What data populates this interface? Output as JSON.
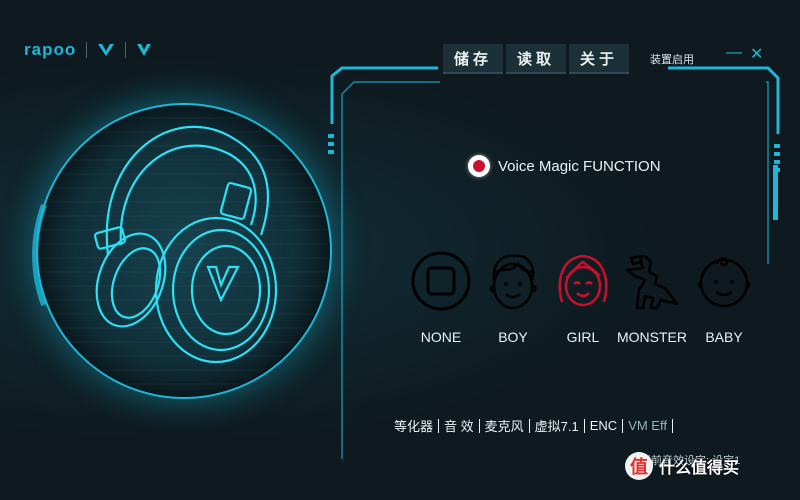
{
  "brand": {
    "name": "rapoo"
  },
  "toolbar": {
    "save_label": "储存",
    "load_label": "读取",
    "about_label": "关于",
    "startup_label": "装置启用",
    "minimize_symbol": "—",
    "close_symbol": "✕"
  },
  "voice_magic": {
    "title": "Voice Magic FUNCTION",
    "enabled": true,
    "modes": [
      {
        "label": "NONE",
        "icon": "none-square-icon",
        "active": false
      },
      {
        "label": "BOY",
        "icon": "boy-face-icon",
        "active": false
      },
      {
        "label": "GIRL",
        "icon": "girl-face-icon",
        "active": true
      },
      {
        "label": "MONSTER",
        "icon": "monster-dinosaur-icon",
        "active": false
      },
      {
        "label": "BABY",
        "icon": "baby-face-icon",
        "active": false
      }
    ]
  },
  "bottom_tabs": [
    {
      "label": "等化器",
      "active": false
    },
    {
      "label": "音 效",
      "active": false
    },
    {
      "label": "麦克风",
      "active": false
    },
    {
      "label": "虚拟7.1",
      "active": false
    },
    {
      "label": "ENC",
      "active": false
    },
    {
      "label": "VM Eff",
      "active": true
    }
  ],
  "status": {
    "text": "当前音效设定: 设定1"
  },
  "watermark": {
    "badge": "值",
    "text": "什么值得买"
  },
  "colors": {
    "accent": "#1db7d8",
    "active_mode": "#c8102e",
    "background": "#0e1a1f",
    "button_bg": "#1c3038"
  }
}
